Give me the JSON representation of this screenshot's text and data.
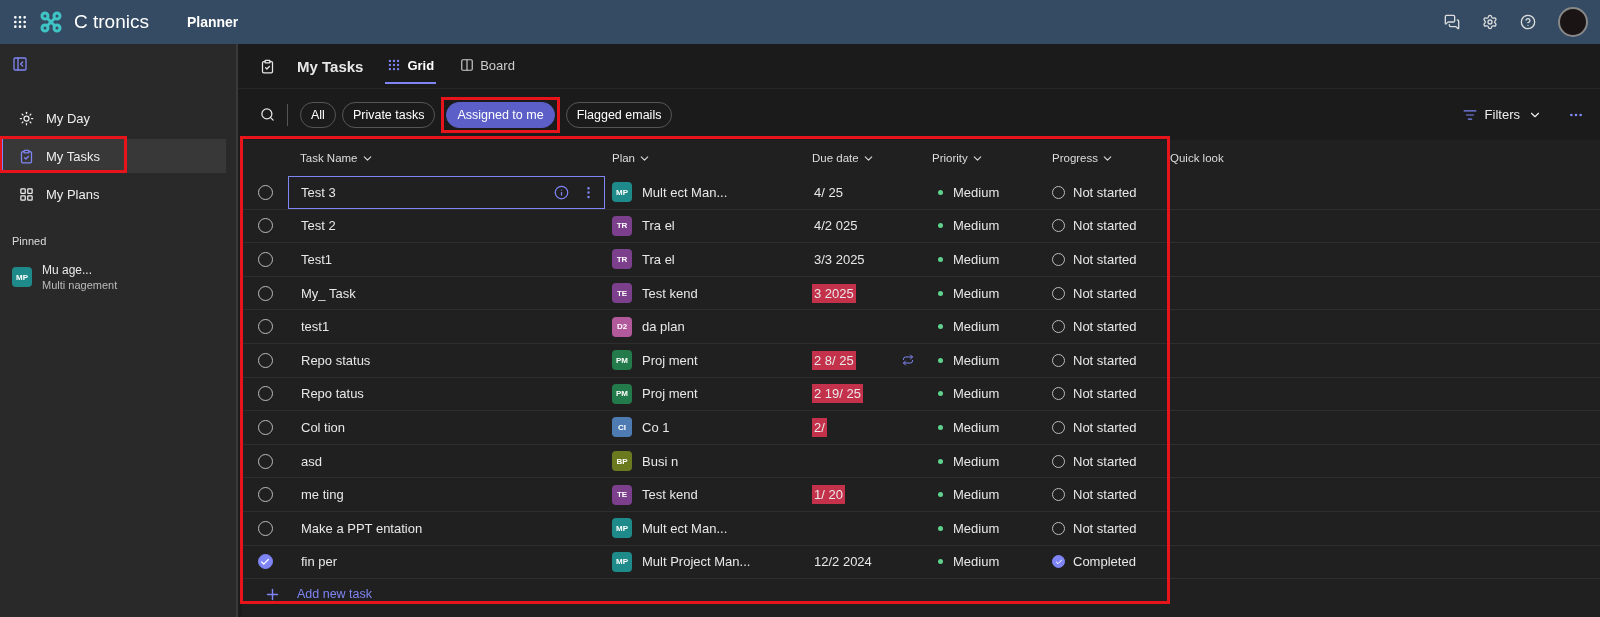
{
  "header": {
    "brand": "C tronics",
    "product": "Planner"
  },
  "sidebar": {
    "items": [
      {
        "label": "My Day",
        "selected": false,
        "highlighted": false
      },
      {
        "label": "My Tasks",
        "selected": true,
        "highlighted": true
      },
      {
        "label": "My Plans",
        "selected": false,
        "highlighted": false
      }
    ],
    "pinned_heading": "Pinned",
    "pinned": [
      {
        "badge": "MP",
        "color": "#1f8a8a",
        "title": "Mu age...",
        "subtitle": "Multi nagement"
      }
    ]
  },
  "page": {
    "title": "My Tasks",
    "views": [
      {
        "label": "Grid",
        "selected": true
      },
      {
        "label": "Board",
        "selected": false
      }
    ]
  },
  "filters": [
    {
      "label": "All",
      "selected": false,
      "highlighted": false
    },
    {
      "label": "Private tasks",
      "selected": false,
      "highlighted": false
    },
    {
      "label": "Assigned to me",
      "selected": true,
      "highlighted": true
    },
    {
      "label": "Flagged emails",
      "selected": false,
      "highlighted": false
    }
  ],
  "filters_button": "Filters",
  "table": {
    "highlighted": true,
    "columns": [
      "Task Name",
      "Plan",
      "Due date",
      "Priority",
      "Progress",
      "Quick look"
    ],
    "rows": [
      {
        "name": "Test 3",
        "focused": true,
        "completed": false,
        "badge": "MP",
        "color": "#1f8a8a",
        "plan": "Mult ect Man...",
        "due": "4/ 25",
        "overdue": false,
        "recurring": false,
        "priority": "Medium",
        "progress": "Not started"
      },
      {
        "name": "Test 2",
        "focused": false,
        "completed": false,
        "badge": "TR",
        "color": "#7b3f8c",
        "plan": "Tra el",
        "due": "4/2 025",
        "overdue": false,
        "recurring": false,
        "priority": "Medium",
        "progress": "Not started"
      },
      {
        "name": "Test1",
        "focused": false,
        "completed": false,
        "badge": "TR",
        "color": "#7b3f8c",
        "plan": "Tra el",
        "due": "3/3 2025",
        "overdue": false,
        "recurring": false,
        "priority": "Medium",
        "progress": "Not started"
      },
      {
        "name": "My_ Task",
        "focused": false,
        "completed": false,
        "badge": "TE",
        "color": "#7b3f8c",
        "plan": "Test kend",
        "due": "3 2025",
        "overdue": true,
        "recurring": false,
        "priority": "Medium",
        "progress": "Not started"
      },
      {
        "name": "test1",
        "focused": false,
        "completed": false,
        "badge": "D2",
        "color": "#b2599b",
        "plan": "da plan",
        "recurring": false,
        "priority": "Medium",
        "progress": "Not started"
      },
      {
        "name": "Repo status",
        "focused": false,
        "completed": false,
        "badge": "PM",
        "color": "#237a4a",
        "plan": "Proj ment",
        "due": "2 8/ 25",
        "overdue": true,
        "recurring": true,
        "priority": "Medium",
        "progress": "Not started"
      },
      {
        "name": "Repo tatus",
        "focused": false,
        "completed": false,
        "badge": "PM",
        "color": "#237a4a",
        "plan": "Proj ment",
        "due": "2 19/ 25",
        "overdue": true,
        "recurring": false,
        "priority": "Medium",
        "progress": "Not started"
      },
      {
        "name": "Col tion",
        "focused": false,
        "completed": false,
        "badge": "CI",
        "color": "#4f7bb3",
        "plan": "Co 1",
        "due": "2/",
        "overdue": true,
        "recurring": false,
        "priority": "Medium",
        "progress": "Not started"
      },
      {
        "name": "asd",
        "focused": false,
        "completed": false,
        "badge": "BP",
        "color": "#6b7a1f",
        "plan": "Busi n",
        "recurring": false,
        "priority": "Medium",
        "progress": "Not started"
      },
      {
        "name": "me ting",
        "focused": false,
        "completed": false,
        "badge": "TE",
        "color": "#7b3f8c",
        "plan": "Test kend",
        "due": "1/ 20",
        "overdue": true,
        "recurring": false,
        "priority": "Medium",
        "progress": "Not started"
      },
      {
        "name": "Make a PPT entation",
        "focused": false,
        "completed": false,
        "badge": "MP",
        "color": "#1f8a8a",
        "plan": "Mult ect Man...",
        "recurring": false,
        "priority": "Medium",
        "progress": "Not started"
      },
      {
        "name": "fin per",
        "focused": false,
        "completed": true,
        "badge": "MP",
        "color": "#1f8a8a",
        "plan": "Mult Project Man...",
        "due": "12/2 2024",
        "overdue": false,
        "recurring": false,
        "priority": "Medium",
        "progress": "Completed"
      }
    ],
    "add_task": "Add new task"
  }
}
